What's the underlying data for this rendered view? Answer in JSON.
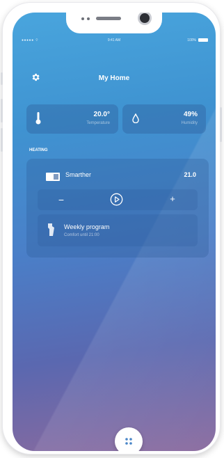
{
  "status_bar": {
    "signal": "●●●●● ⌔",
    "time": "9:41 AM",
    "battery": "100%"
  },
  "header": {
    "title": "My Home",
    "settings_icon": "gear-icon"
  },
  "cards": {
    "temperature": {
      "value": "20.0°",
      "label": "Temperature",
      "icon": "thermometer-icon"
    },
    "humidity": {
      "value": "49%",
      "label": "Humidity",
      "icon": "drop-icon"
    }
  },
  "heating": {
    "section_label": "HEATING",
    "device_name": "Smarther",
    "device_value": "21.0",
    "device_icon": "thermostat-icon",
    "minus_label": "−",
    "plus_label": "+",
    "mode_icon": "play-circle-icon",
    "program": {
      "title": "Weekly program",
      "subtitle": "Comfort until 21:00",
      "icon": "program-icon"
    }
  },
  "fab": {
    "icon": "grid-icon"
  },
  "colors": {
    "gradient_top": "#49a5dd",
    "gradient_bottom": "#8a6a9e",
    "card": "#2b5896"
  }
}
